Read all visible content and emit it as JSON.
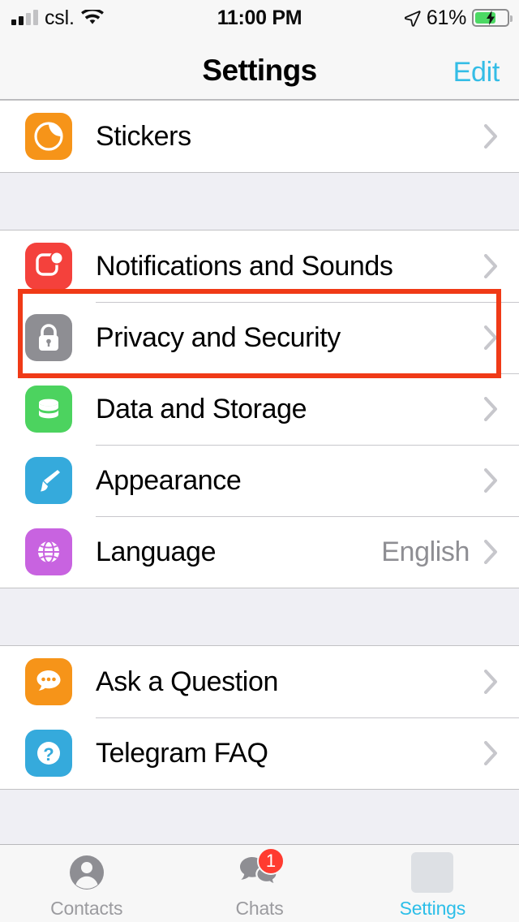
{
  "status_bar": {
    "carrier": "csl.",
    "time": "11:00 PM",
    "battery_percent": "61%",
    "signal_icon": "signal-bars-icon",
    "wifi_icon": "wifi-icon",
    "location_icon": "location-arrow-icon",
    "battery_icon": "battery-charging-icon",
    "battery_level": 60,
    "charging": true
  },
  "nav": {
    "title": "Settings",
    "edit_label": "Edit"
  },
  "sections": [
    {
      "rows": [
        {
          "label": "Stickers",
          "icon": "stickers-icon",
          "color": "#F69419",
          "value": "",
          "accessory": "chevron-right-icon"
        }
      ]
    },
    {
      "rows": [
        {
          "label": "Notifications and Sounds",
          "icon": "notifications-icon",
          "color": "#F4413C",
          "value": "",
          "accessory": "chevron-right-icon"
        },
        {
          "label": "Privacy and Security",
          "icon": "lock-icon",
          "color": "#8E8E93",
          "value": "",
          "accessory": "chevron-right-icon",
          "highlighted": true
        },
        {
          "label": "Data and Storage",
          "icon": "database-icon",
          "color": "#4CD35F",
          "value": "",
          "accessory": "chevron-right-icon"
        },
        {
          "label": "Appearance",
          "icon": "paintbrush-icon",
          "color": "#35AADC",
          "value": "",
          "accessory": "chevron-right-icon"
        },
        {
          "label": "Language",
          "icon": "globe-icon",
          "color": "#C863E0",
          "value": "English",
          "accessory": "chevron-right-icon"
        }
      ]
    },
    {
      "rows": [
        {
          "label": "Ask a Question",
          "icon": "speech-bubble-icon",
          "color": "#F69419",
          "value": "",
          "accessory": "chevron-right-icon"
        },
        {
          "label": "Telegram FAQ",
          "icon": "question-mark-icon",
          "color": "#35AADC",
          "value": "",
          "accessory": "chevron-right-icon"
        }
      ]
    }
  ],
  "highlight": {
    "target": "Privacy and Security",
    "color": "#F03A17"
  },
  "tab_bar": {
    "tabs": [
      {
        "label": "Contacts",
        "icon": "person-icon",
        "active": false,
        "badge": ""
      },
      {
        "label": "Chats",
        "icon": "chats-icon",
        "active": false,
        "badge": "1"
      },
      {
        "label": "Settings",
        "icon": "settings-placeholder-icon",
        "active": true,
        "badge": ""
      }
    ]
  },
  "colors": {
    "accent": "#2CBEE8",
    "badge": "#FF3B30",
    "highlight": "#F03A17",
    "separator": "#C8C7CC",
    "group_background": "#EFEFF4"
  }
}
